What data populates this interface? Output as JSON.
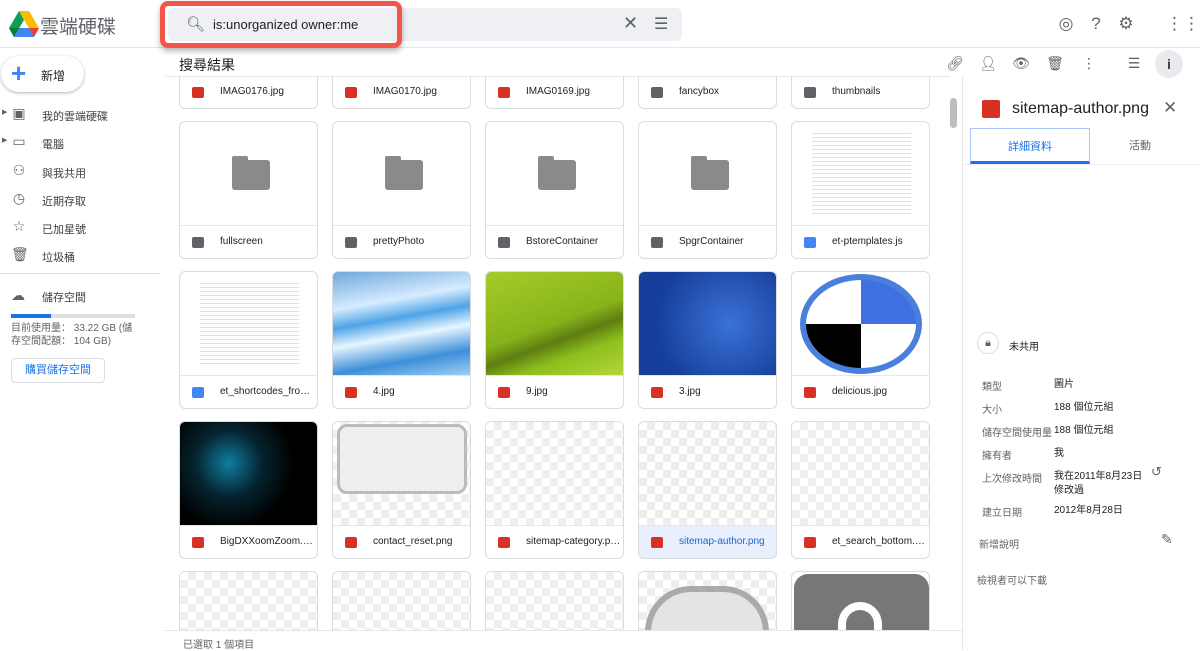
{
  "app": {
    "name": "雲端硬碟"
  },
  "search": {
    "query": "is:unorganized owner:me"
  },
  "sidebar": {
    "new_label": "新增",
    "items": [
      {
        "label": "我的雲端硬碟",
        "icon": "my-drive-icon",
        "expandable": true
      },
      {
        "label": "電腦",
        "icon": "computers-icon",
        "expandable": true
      },
      {
        "label": "與我共用",
        "icon": "shared-icon",
        "expandable": false
      },
      {
        "label": "近期存取",
        "icon": "clock-icon",
        "expandable": false
      },
      {
        "label": "已加星號",
        "icon": "star-icon",
        "expandable": false
      },
      {
        "label": "垃圾桶",
        "icon": "trash-icon",
        "expandable": false
      }
    ],
    "storage_label": "儲存空間",
    "storage_used_fraction": 0.32,
    "usage_text": "目前使用量： 33.22 GB (儲存空間配額： 104 GB)",
    "buy_label": "購買儲存空間"
  },
  "main": {
    "title": "搜尋結果",
    "status": "已選取 1 個項目",
    "files": [
      {
        "name": "IMAG0176.jpg",
        "type": "img",
        "thumb": "none"
      },
      {
        "name": "IMAG0170.jpg",
        "type": "img",
        "thumb": "none"
      },
      {
        "name": "IMAG0169.jpg",
        "type": "img",
        "thumb": "none"
      },
      {
        "name": "fancybox",
        "type": "folder",
        "thumb": "none"
      },
      {
        "name": "thumbnails",
        "type": "folder",
        "thumb": "none"
      },
      {
        "name": "fullscreen",
        "type": "folder",
        "thumb": "folder"
      },
      {
        "name": "prettyPhoto",
        "type": "folder",
        "thumb": "folder"
      },
      {
        "name": "BstoreContainer",
        "type": "folder",
        "thumb": "folder"
      },
      {
        "name": "SpgrContainer",
        "type": "folder",
        "thumb": "folder"
      },
      {
        "name": "et-ptemplates.js",
        "type": "doc",
        "thumb": "code"
      },
      {
        "name": "et_shortcodes_frontend.js",
        "type": "doc",
        "thumb": "code"
      },
      {
        "name": "4.jpg",
        "type": "img",
        "thumb": "streak"
      },
      {
        "name": "9.jpg",
        "type": "img",
        "thumb": "green"
      },
      {
        "name": "3.jpg",
        "type": "img",
        "thumb": "blue"
      },
      {
        "name": "delicious.jpg",
        "type": "img",
        "thumb": "delicious"
      },
      {
        "name": "BigDXXoomZoom.jpg",
        "type": "img",
        "thumb": "clock"
      },
      {
        "name": "contact_reset.png",
        "type": "img",
        "thumb": "reset"
      },
      {
        "name": "sitemap-category.png",
        "type": "img",
        "thumb": "checker"
      },
      {
        "name": "sitemap-author.png",
        "type": "img",
        "thumb": "checker",
        "selected": true
      },
      {
        "name": "et_search_bottom.png",
        "type": "img",
        "thumb": "checker"
      },
      {
        "name": "",
        "type": "img",
        "thumb": "checker"
      },
      {
        "name": "",
        "type": "img",
        "thumb": "checker"
      },
      {
        "name": "",
        "type": "img",
        "thumb": "checker"
      },
      {
        "name": "",
        "type": "img",
        "thumb": "play"
      },
      {
        "name": "",
        "type": "img",
        "thumb": "dark"
      }
    ]
  },
  "details": {
    "title": "sitemap-author.png",
    "tabs": [
      "詳細資料",
      "活動"
    ],
    "sharing": "未共用",
    "rows": [
      {
        "k": "類型",
        "v": "圖片"
      },
      {
        "k": "大小",
        "v": "188 個位元組"
      },
      {
        "k": "儲存空間使用量",
        "v": "188 個位元組"
      },
      {
        "k": "擁有者",
        "v": "我"
      },
      {
        "k": "上次修改時間",
        "v": "我在2011年8月23日修改過"
      },
      {
        "k": "建立日期",
        "v": "2012年8月28日"
      }
    ],
    "add_desc": "新增說明",
    "viewer_download": "檢視者可以下載"
  }
}
